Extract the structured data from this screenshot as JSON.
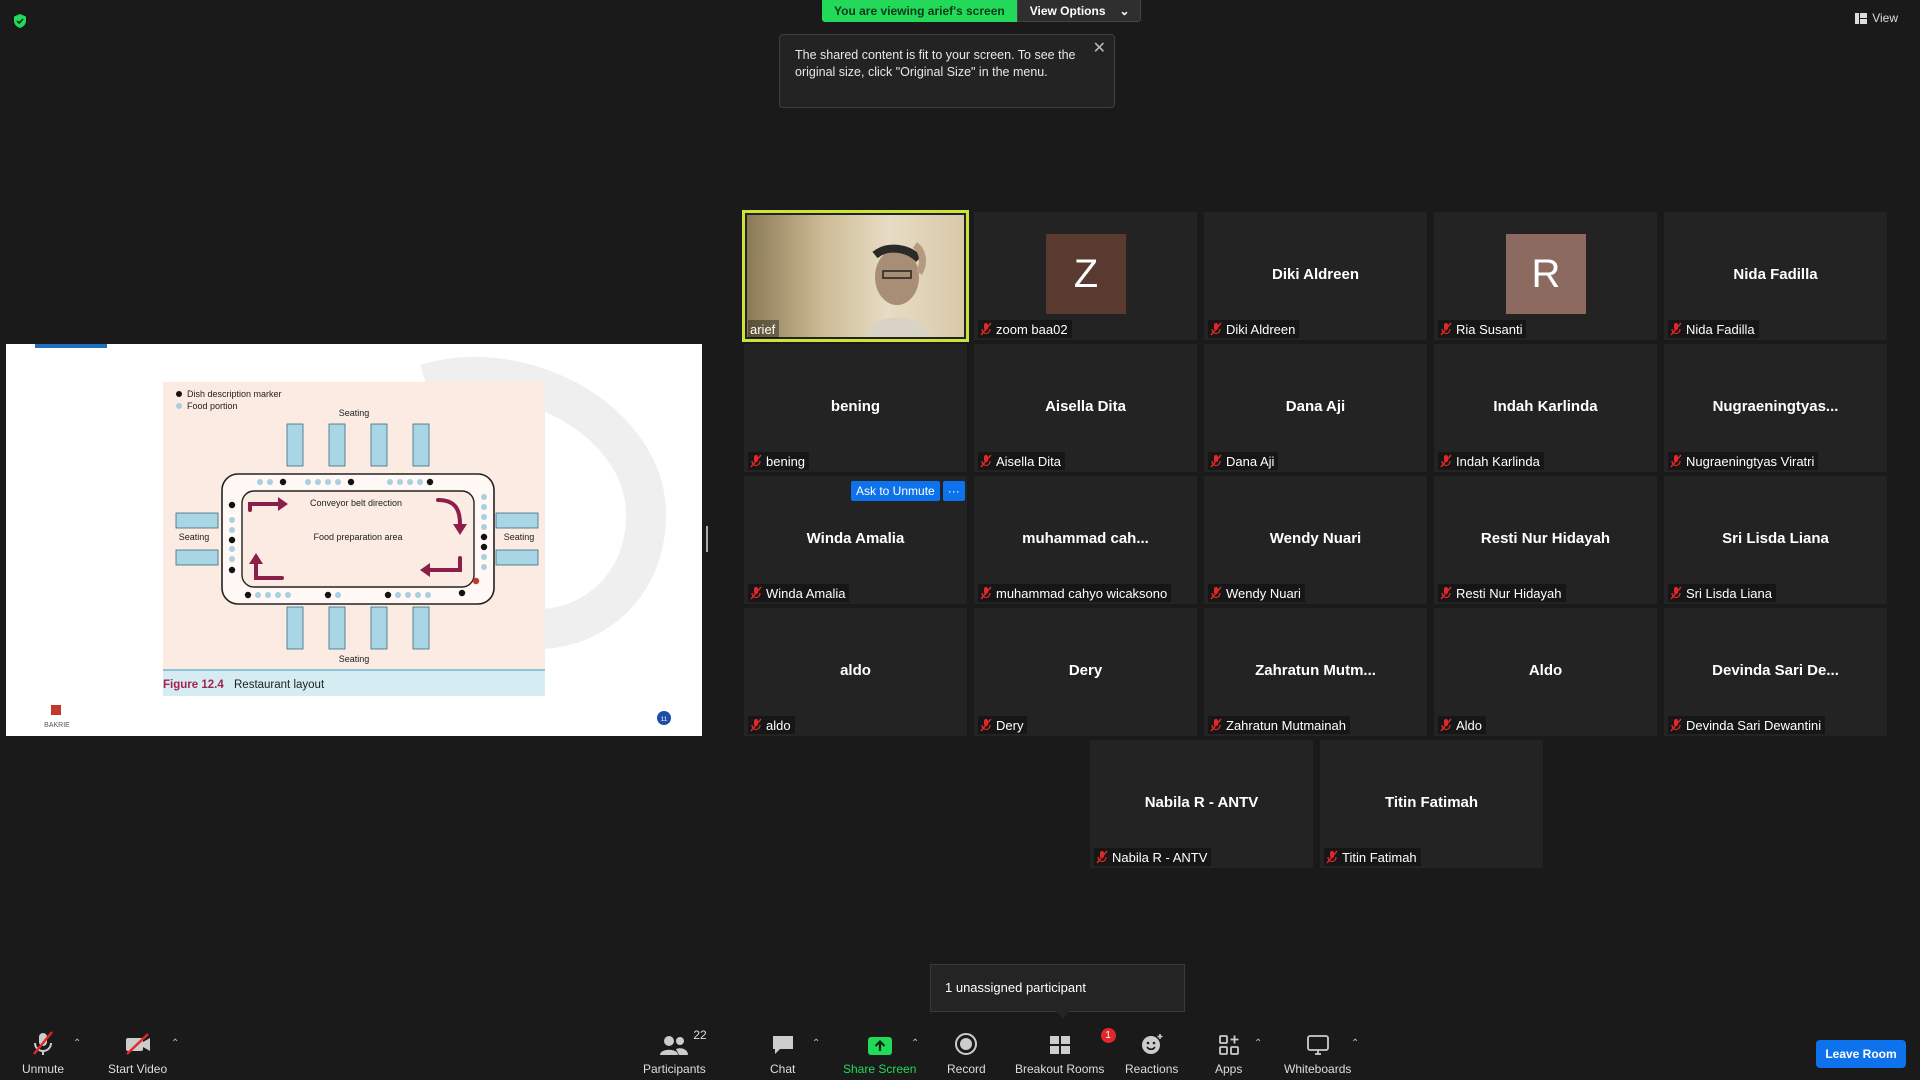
{
  "top": {
    "viewing_label": "You are viewing arief's screen",
    "view_options_label": "View Options",
    "tooltip_text": "The shared content is fit to your screen. To see the original size, click \"Original Size\" in the menu.",
    "view_label": "View"
  },
  "slide": {
    "legend_marker": "Dish description marker",
    "legend_food": "Food portion",
    "seating": "Seating",
    "conveyor": "Conveyor belt direction",
    "prep": "Food preparation area",
    "figure_num": "Figure 12.4",
    "figure_title": "Restaurant layout",
    "logo_text": "BAKRIE",
    "page_num": "11"
  },
  "tiles": [
    {
      "big": "",
      "tag": "arief",
      "muted": false,
      "video": true
    },
    {
      "big": "",
      "tag": "zoom baa02",
      "muted": true,
      "avatar": "Z",
      "avatar_color": "#5a3a30"
    },
    {
      "big": "Diki Aldreen",
      "tag": "Diki Aldreen",
      "muted": true
    },
    {
      "big": "",
      "tag": "Ria Susanti",
      "muted": true,
      "avatar": "R",
      "avatar_color": "#8d6a60"
    },
    {
      "big": "Nida Fadilla",
      "tag": "Nida Fadilla",
      "muted": true
    },
    {
      "big": "bening",
      "tag": "bening",
      "muted": true
    },
    {
      "big": "Aisella Dita",
      "tag": "Aisella Dita",
      "muted": true
    },
    {
      "big": "Dana Aji",
      "tag": "Dana Aji",
      "muted": true
    },
    {
      "big": "Indah Karlinda",
      "tag": "Indah Karlinda",
      "muted": true
    },
    {
      "big": "Nugraeningtyas...",
      "tag": "Nugraeningtyas Viratri",
      "muted": true
    },
    {
      "big": "Winda Amalia",
      "tag": "Winda Amalia",
      "muted": true
    },
    {
      "big": "muhammad  cah...",
      "tag": "muhammad cahyo wicaksono",
      "muted": true
    },
    {
      "big": "Wendy Nuari",
      "tag": "Wendy Nuari",
      "muted": true
    },
    {
      "big": "Resti Nur Hidayah",
      "tag": "Resti Nur Hidayah",
      "muted": true
    },
    {
      "big": "Sri Lisda Liana",
      "tag": "Sri Lisda Liana",
      "muted": true
    },
    {
      "big": "aldo",
      "tag": "aldo",
      "muted": true
    },
    {
      "big": "Dery",
      "tag": "Dery",
      "muted": true
    },
    {
      "big": "Zahratun  Mutm...",
      "tag": "Zahratun Mutmainah",
      "muted": true
    },
    {
      "big": "Aldo",
      "tag": "Aldo",
      "muted": true
    },
    {
      "big": "Devinda  Sari  De...",
      "tag": "Devinda Sari Dewantini",
      "muted": true
    },
    {
      "big": "Nabila R - ANTV",
      "tag": "Nabila R - ANTV",
      "muted": true
    },
    {
      "big": "Titin Fatimah",
      "tag": "Titin Fatimah",
      "muted": true
    }
  ],
  "ask_unmute": "Ask to Unmute",
  "ask_more": "···",
  "popup": "1 unassigned participant",
  "toolbar": {
    "unmute": "Unmute",
    "start_video": "Start Video",
    "participants": "Participants",
    "participants_count": "22",
    "chat": "Chat",
    "share_screen": "Share Screen",
    "record": "Record",
    "breakout": "Breakout Rooms",
    "breakout_badge": "1",
    "reactions": "Reactions",
    "apps": "Apps",
    "whiteboards": "Whiteboards",
    "leave": "Leave Room"
  },
  "colors": {
    "accent_blue": "#0e72ed",
    "share_green": "#23d959",
    "active_outline": "#cde33a",
    "muted_red": "#e02828"
  }
}
